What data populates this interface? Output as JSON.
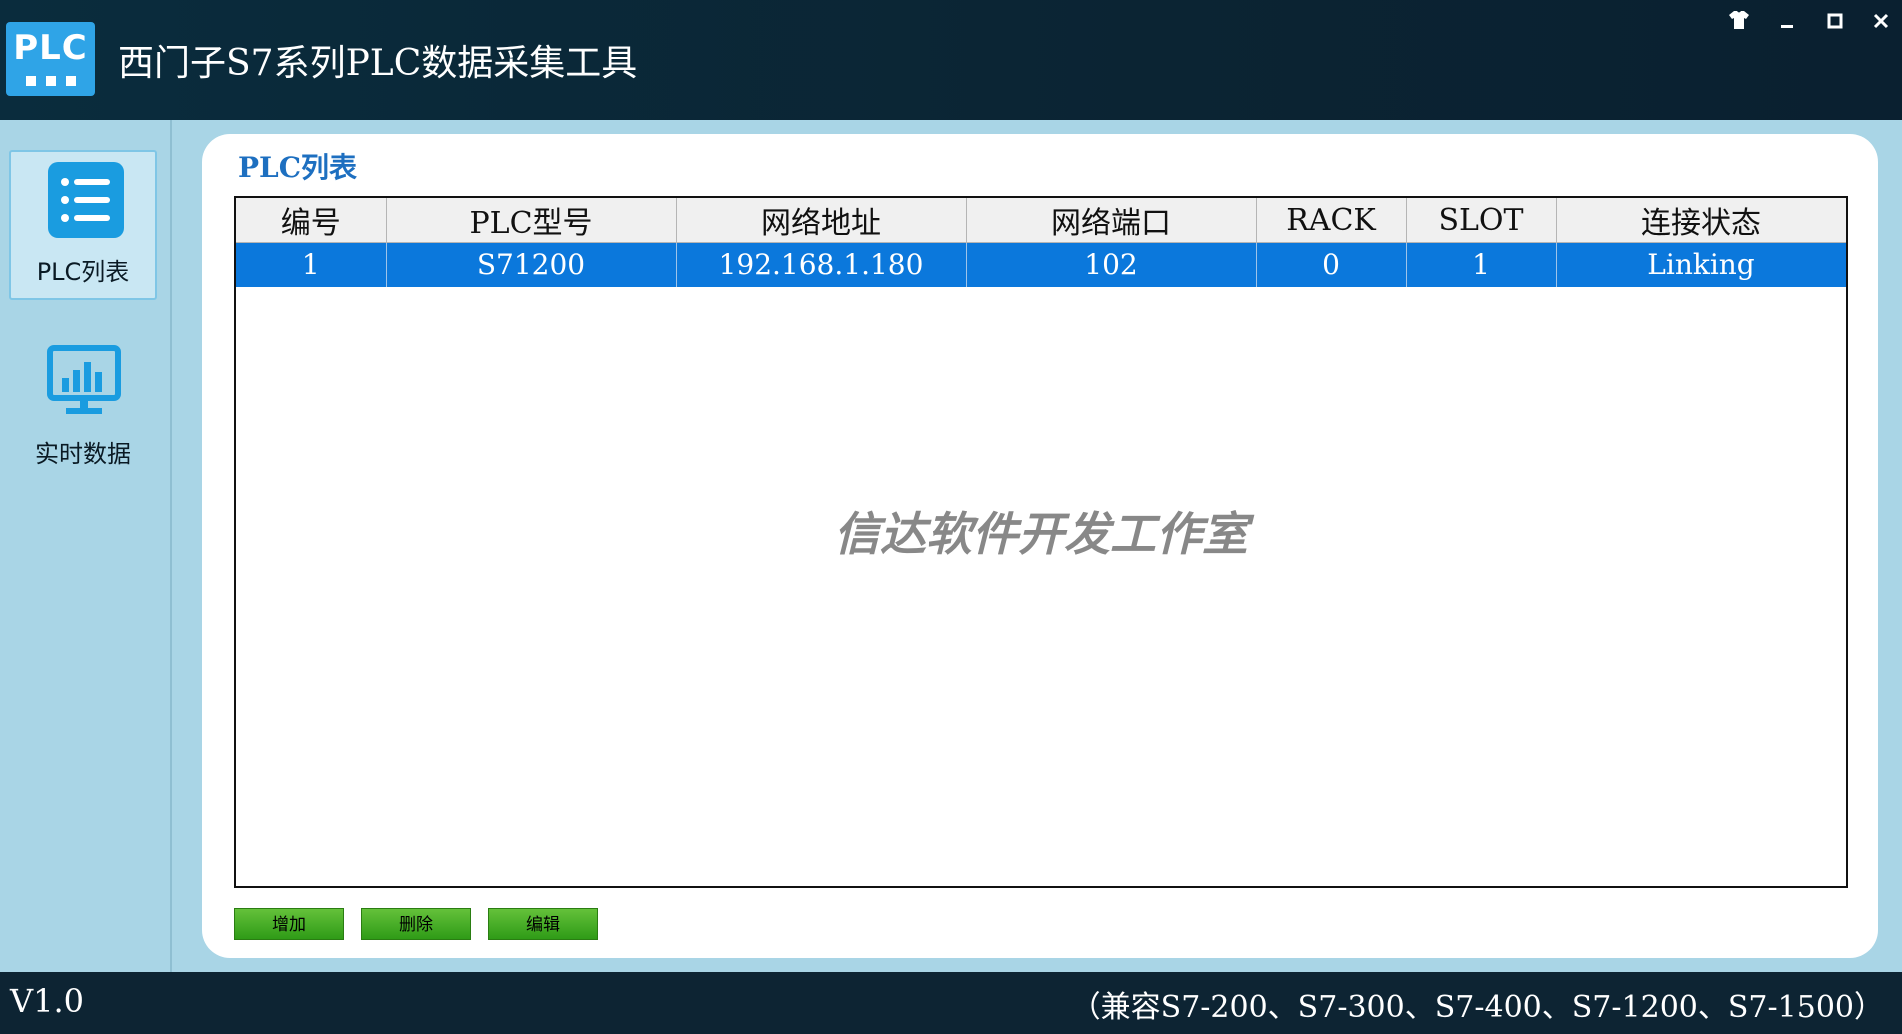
{
  "app": {
    "logo_text": "PLC",
    "title": "西门子S7系列PLC数据采集工具"
  },
  "window_controls": {
    "skin_icon": "shirt-icon",
    "minimize_icon": "minimize-icon",
    "maximize_icon": "maximize-icon",
    "close_icon": "close-icon"
  },
  "sidebar": {
    "items": [
      {
        "label": "PLC列表",
        "icon": "list-icon",
        "active": true
      },
      {
        "label": "实时数据",
        "icon": "chart-monitor-icon",
        "active": false
      }
    ]
  },
  "panel": {
    "title": "PLC列表",
    "watermark": "信达软件开发工作室",
    "columns": [
      "编号",
      "PLC型号",
      "网络地址",
      "网络端口",
      "RACK",
      "SLOT",
      "连接状态"
    ],
    "rows": [
      [
        "1",
        "S71200",
        "192.168.1.180",
        "102",
        "0",
        "1",
        "Linking"
      ]
    ],
    "buttons": {
      "add": "增加",
      "delete": "删除",
      "edit": "编辑"
    }
  },
  "statusbar": {
    "version": "V1.0",
    "compat": "（兼容S7-200、S7-300、S7-400、S7-1200、S7-1500）"
  },
  "colors": {
    "titlebar": "#0b2433",
    "accent": "#2fa4e7",
    "selected_row": "#0b78dc",
    "button": "#4aaf28"
  }
}
